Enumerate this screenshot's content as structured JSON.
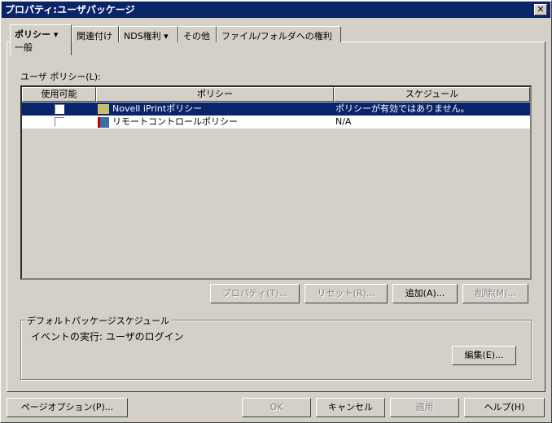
{
  "window": {
    "title": "プロパティ:ユーザパッケージ",
    "close": "✕"
  },
  "tabs": [
    {
      "label": "ポリシー ▾",
      "sub": "一般"
    },
    {
      "label": "関連付け"
    },
    {
      "label": "NDS権利 ▾"
    },
    {
      "label": "その他"
    },
    {
      "label": "ファイル/フォルダへの権利"
    }
  ],
  "policies": {
    "label": "ユーザ ポリシー(L):",
    "headers": [
      "使用可能",
      "ポリシー",
      "スケジュール"
    ],
    "rows": [
      {
        "name": "Novell iPrintポリシー",
        "schedule": "ポリシーが有効ではありません。",
        "enabled": false,
        "selected": true
      },
      {
        "name": "リモートコントロールポリシー",
        "schedule": "N/A",
        "enabled": false,
        "selected": false
      }
    ]
  },
  "buttons": {
    "properties": "プロパティ(T)...",
    "reset": "リセット(R)...",
    "add": "追加(A)...",
    "delete": "削除(M)...",
    "edit": "編集(E)...",
    "page_options": "ページオプション(P)...",
    "ok": "OK",
    "cancel": "キャンセル",
    "apply": "適用",
    "help": "ヘルプ(H)"
  },
  "schedule": {
    "group": "デフォルトパッケージスケジュール",
    "event": "イベントの実行: ユーザのログイン"
  }
}
